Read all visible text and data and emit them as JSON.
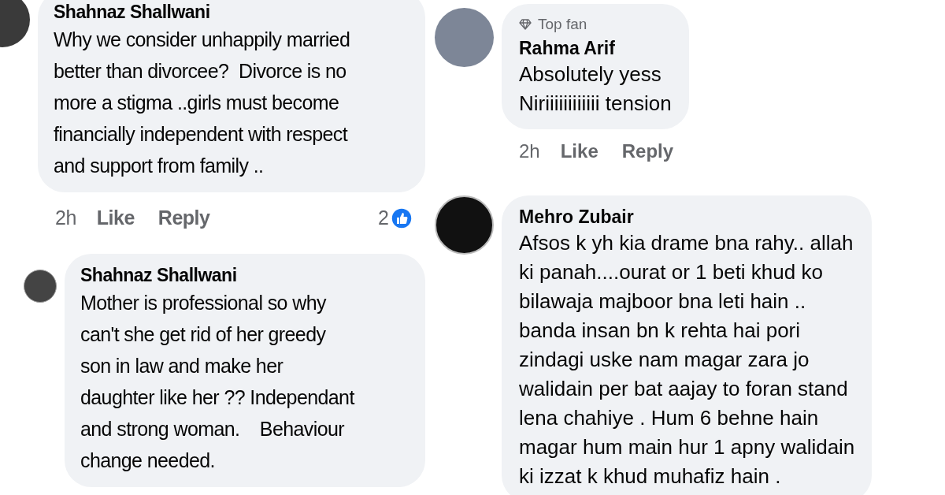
{
  "left_column": [
    {
      "author": "Shahnaz Shallwani",
      "lines": [
        "Why we consider unhappily married",
        "better than divorcee?  Divorce is no",
        "more a stigma ..girls must become",
        "financially independent with respect",
        "and support from family .."
      ],
      "actions": {
        "time": "2h",
        "like": "Like",
        "reply": "Reply",
        "reaction_count": "2"
      }
    },
    {
      "author": "Shahnaz Shallwani",
      "lines": [
        "Mother is professional so why",
        "can't she get rid of her greedy",
        "son in law and make her",
        "daughter like her ?? Independant",
        "and strong woman.    Behaviour",
        "change needed."
      ]
    }
  ],
  "right_column": [
    {
      "badge": "Top fan",
      "author": "Rahma Arif",
      "lines": [
        "Absolutely yess",
        "Niriiiiiiiiiiii tension"
      ],
      "actions": {
        "time": "2h",
        "like": "Like",
        "reply": "Reply"
      }
    },
    {
      "author": "Mehro Zubair",
      "lines": [
        "Afsos k yh kia drame bna rahy.. allah",
        "ki panah....ourat or 1 beti khud ko",
        "bilawaja majboor bna leti hain ..",
        "banda insan bn k rehta hai pori",
        "zindagi uske nam magar zara jo",
        "walidain per bat aajay to foran stand",
        "lena chahiye . Hum 6 behne hain",
        "magar hum main hur 1 apny walidain",
        "ki izzat k khud muhafiz hain ."
      ]
    }
  ]
}
